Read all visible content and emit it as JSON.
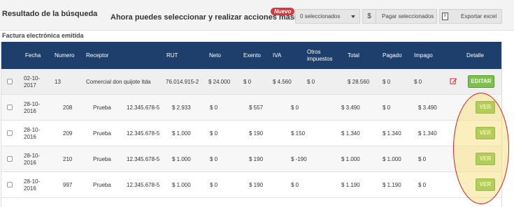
{
  "header": {
    "result_title": "Resultado de la búsqueda",
    "masivas_text": "Ahora puedes seleccionar y realizar acciones masivas!",
    "nuevo_badge": "Nuevo",
    "selected_dropdown": "0 seleccionados",
    "pagar_icon": "$",
    "pagar_label": "Pagar seleccionados",
    "export_label": "Exportar excel",
    "export_icon_glyph": "X"
  },
  "section_title": "Factura electrónica emitida",
  "table": {
    "columns": {
      "fecha": "Fecha",
      "numero": "Numero",
      "receptor": "Receptor",
      "rut": "RUT",
      "neto": "Neto",
      "exento": "Exento",
      "iva": "IVA",
      "otros": "Otros impuestos",
      "total": "Total",
      "pagado": "Pagado",
      "impago": "Impago",
      "detalle": "Detalle"
    },
    "rows": [
      {
        "fecha": "02-10-2017",
        "numero": "13",
        "receptor": "Comercial don quijote ltda",
        "rut": "76.014.915-2",
        "neto": "$ 24.000",
        "exento": "$ 0",
        "iva": "$ 4.560",
        "otros": "$ 0",
        "total": "$ 28.560",
        "pagado": "$ 0",
        "impago": "$ 0",
        "action": "EDITAR"
      },
      {
        "fecha": "28-10-2016",
        "numero": "208",
        "receptor": "Prueba",
        "rut": "12.345.678-5",
        "neto": "$ 2.933",
        "exento": "$ 0",
        "iva": "$ 557",
        "otros": "$ 0",
        "total": "$ 3.490",
        "pagado": "$ 0",
        "impago": "$ 3.490",
        "action": "VER"
      },
      {
        "fecha": "28-10-2016",
        "numero": "209",
        "receptor": "Prueba",
        "rut": "12.345.678-5",
        "neto": "$ 1.000",
        "exento": "$ 0",
        "iva": "$ 190",
        "otros": "$ 150",
        "total": "$ 1.340",
        "pagado": "$ 1.340",
        "impago": "$ 1.340",
        "action": "VER"
      },
      {
        "fecha": "28-10-2016",
        "numero": "210",
        "receptor": "Prueba",
        "rut": "12.345.678-5",
        "neto": "$ 1.000",
        "exento": "$ 0",
        "iva": "$ 190",
        "otros": "$ -190",
        "total": "$ 1.000",
        "pagado": "$ 1.000",
        "impago": "$ 0",
        "action": "VER"
      },
      {
        "fecha": "28-10-2016",
        "numero": "997",
        "receptor": "Prueba",
        "rut": "12.345.678-5",
        "neto": "$ 1.000",
        "exento": "$ 0",
        "iva": "$ 190",
        "otros": "$ 0",
        "total": "$ 1.190",
        "pagado": "$ 1.190",
        "impago": "$ 0",
        "action": "VER"
      }
    ]
  },
  "colors": {
    "header_bg": "#1e3f6b",
    "button_green": "#7cc24a",
    "badge_red": "#d9383a",
    "highlight_outline": "#e01a1a",
    "highlight_fill": "#f6dc6e"
  }
}
